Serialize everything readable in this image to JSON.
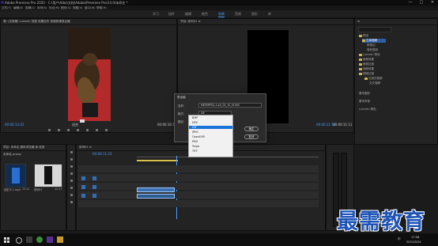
{
  "window": {
    "title": "Adobe Premiere Pro 2020 - C:\\用户\\Aibo\\文档\\Adobe\\Premiere Pro\\14.0\\未命名 *",
    "controls": [
      "—",
      "□",
      "✕"
    ]
  },
  "menu": [
    "文件(F)",
    "编辑(E)",
    "剪辑(C)",
    "序列(S)",
    "标记(M)",
    "图形(G)",
    "视图(V)",
    "窗口(W)",
    "帮助(H)"
  ],
  "workspaces": {
    "items": [
      "学习",
      "组件",
      "编辑",
      "颜色",
      "效果",
      "音频",
      "图形",
      "库"
    ],
    "active_index": 4
  },
  "source_monitor": {
    "tab": "源: (无剪辑)   Lumetri 范围   效果控件   音频剪辑混合器",
    "timecode_left": "00:00:13:22",
    "timecode_right": "00:00:16:18",
    "fit": "适合"
  },
  "program_monitor": {
    "tab": "节目: 序列01 ≡",
    "timecode_left": "00:00:11:13",
    "timecode_right": "00:00:11:11",
    "fit": "完整"
  },
  "effects": {
    "items": [
      "预设",
      "Lumetri 预设",
      "音频效果",
      "音频过渡",
      "视频效果",
      "视频过渡",
      "立体视频",
      "交叉溶解",
      "沉浸式视频"
    ],
    "sub": [
      "斜角边",
      "卷积混响"
    ],
    "lower": [
      "基本图形",
      "基本声音",
      "Lumetri 颜色"
    ]
  },
  "project": {
    "tab": "项目: 未命名  媒体浏览器  库  信息",
    "name": "未命名.prproj",
    "items": [
      {
        "label": "自定义-1.mp4",
        "dur": "11:11"
      },
      {
        "label": "序列01",
        "dur": "11:11"
      }
    ]
  },
  "timeline": {
    "tab": "序列01 ≡",
    "timecode": "00:00:11:23",
    "tracks": [
      "V3",
      "V2",
      "V1",
      "A1",
      "A2",
      "A3"
    ]
  },
  "dialog": {
    "title": "导出帧",
    "name_label": "名称:",
    "name_value": "MKTBRPSQ-4-p0_00_10_01000",
    "format_label": "格式:",
    "format_value": "GIF",
    "path_label": "路径:",
    "browse": "浏览...",
    "ok": "确定",
    "cancel": "取消",
    "import_label": "导入到项目中"
  },
  "format_options": [
    "BMP",
    "DPX",
    "GIF",
    "JPEG",
    "OpenEXR",
    "PNG",
    "Targa",
    "TIFF"
  ],
  "format_selected": "GIF",
  "taskbar": {
    "time": "17:58",
    "date": "2021/9/24",
    "lang": "中"
  },
  "watermark": "最需教育",
  "colors": {
    "accent": "#4a9dff",
    "clip": "#3a6fb0",
    "watermark": "#1e54b8"
  }
}
